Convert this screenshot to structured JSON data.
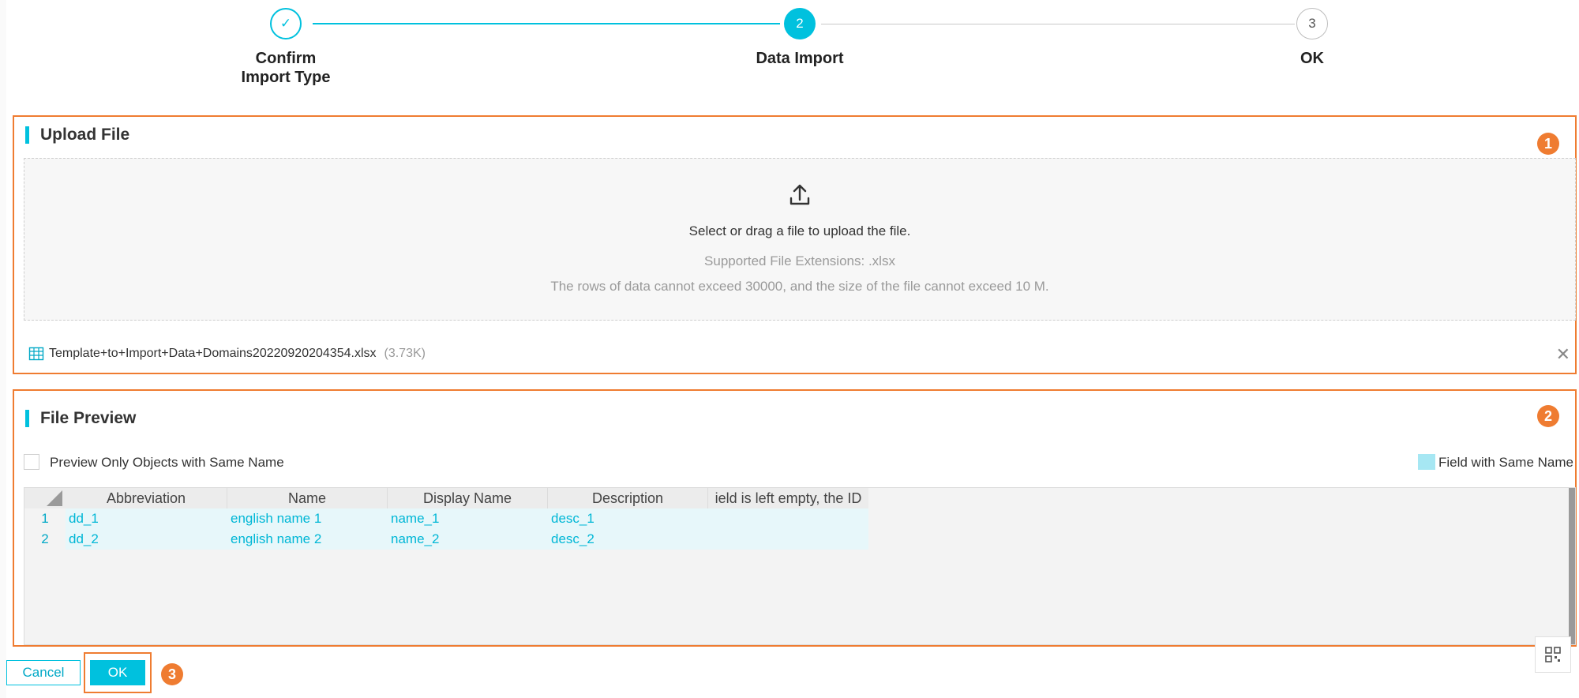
{
  "steps": [
    {
      "number": "✓",
      "label": "Confirm\nImport Type",
      "state": "done"
    },
    {
      "number": "2",
      "label": "Data Import",
      "state": "active"
    },
    {
      "number": "3",
      "label": "OK",
      "state": "todo"
    }
  ],
  "upload": {
    "title": "Upload File",
    "badge": "1",
    "dropzone_main": "Select or drag a file to upload the file.",
    "dropzone_extensions": "Supported File Extensions: .xlsx",
    "dropzone_limits": "The rows of data cannot exceed 30000, and the size of the file cannot exceed 10 M.",
    "file_name": "Template+to+Import+Data+Domains20220920204354.xlsx",
    "file_size": "(3.73K)",
    "close_glyph": "✕"
  },
  "preview": {
    "title": "File Preview",
    "badge": "2",
    "checkbox_label": "Preview Only Objects with Same Name",
    "legend_label": "Field with Same Name",
    "columns": [
      "Abbreviation",
      "Name",
      "Display Name",
      "Description",
      "ield is left empty, the ID"
    ],
    "rows": [
      {
        "num": "1",
        "cells": [
          "dd_1",
          "english name 1",
          "name_1",
          "desc_1",
          ""
        ]
      },
      {
        "num": "2",
        "cells": [
          "dd_2",
          "english name 2",
          "name_2",
          "desc_2",
          ""
        ]
      }
    ]
  },
  "footer": {
    "cancel_label": "Cancel",
    "ok_label": "OK",
    "badge": "3"
  },
  "colors": {
    "accent": "#00c1de",
    "highlight_border": "#ef7c31",
    "same_name": "#a6e7f3"
  }
}
